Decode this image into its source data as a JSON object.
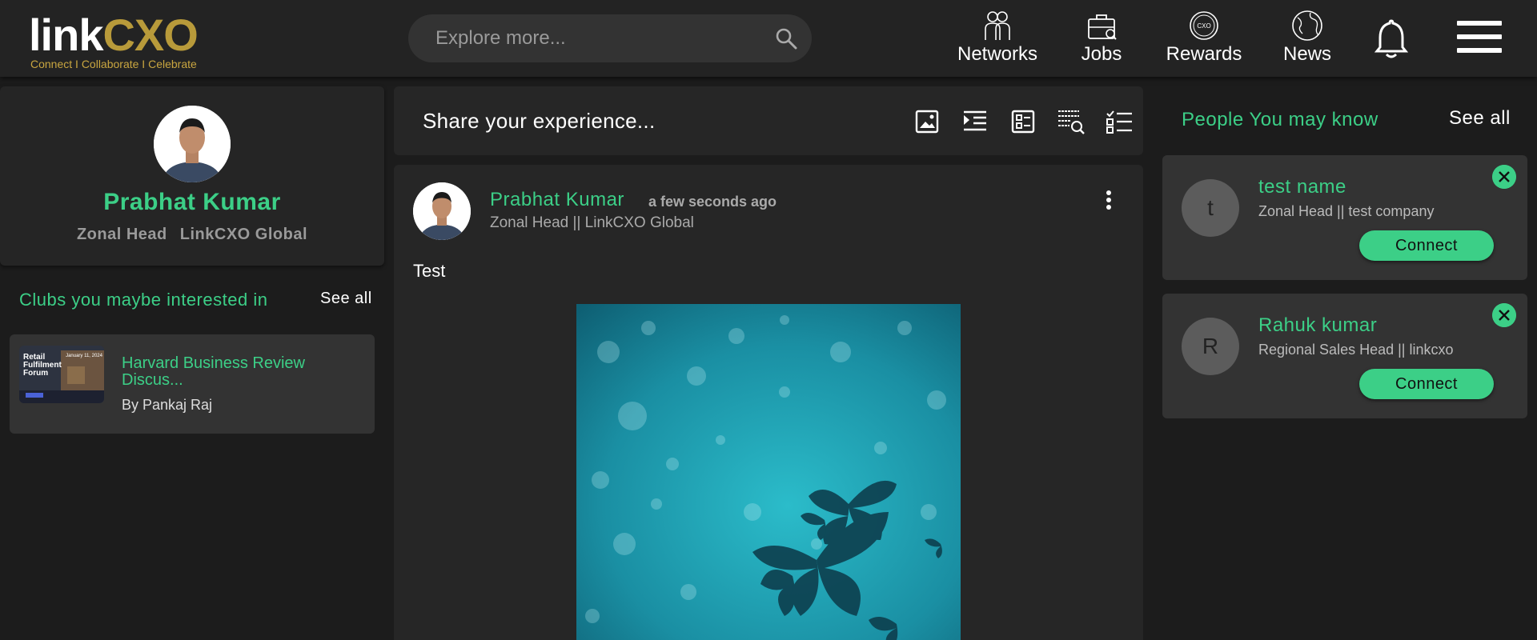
{
  "brand": {
    "logo_link": "link",
    "logo_cxo": "CXO",
    "tagline": "Connect I Collaborate I Celebrate"
  },
  "search": {
    "placeholder": "Explore more..."
  },
  "nav": {
    "networks": "Networks",
    "jobs": "Jobs",
    "rewards": "Rewards",
    "news": "News"
  },
  "profile": {
    "name": "Prabhat Kumar",
    "title": "Zonal Head",
    "company": "LinkCXO Global"
  },
  "clubs": {
    "heading": "Clubs you maybe interested in",
    "see_all": "See all",
    "items": [
      {
        "title": "Harvard Business Review Discus...",
        "by": "By Pankaj Raj",
        "thumb_title": "Retail Fulfilment Forum",
        "thumb_date": "January 11, 2024"
      }
    ]
  },
  "composer": {
    "prompt": "Share your experience..."
  },
  "post": {
    "author": "Prabhat Kumar",
    "time": "a few seconds ago",
    "subtitle": "Zonal Head || LinkCXO Global",
    "text": "Test"
  },
  "people": {
    "heading": "People You may know",
    "see_all": "See all",
    "items": [
      {
        "initial": "t",
        "name": "test name",
        "role": "Zonal Head || test company",
        "action": "Connect"
      },
      {
        "initial": "R",
        "name": "Rahuk kumar",
        "role": "Regional Sales Head || linkcxo",
        "action": "Connect"
      }
    ]
  },
  "colors": {
    "accent": "#3ccf87",
    "gold": "#b89a3a",
    "background": "#1c1c1c",
    "card": "#262626"
  }
}
